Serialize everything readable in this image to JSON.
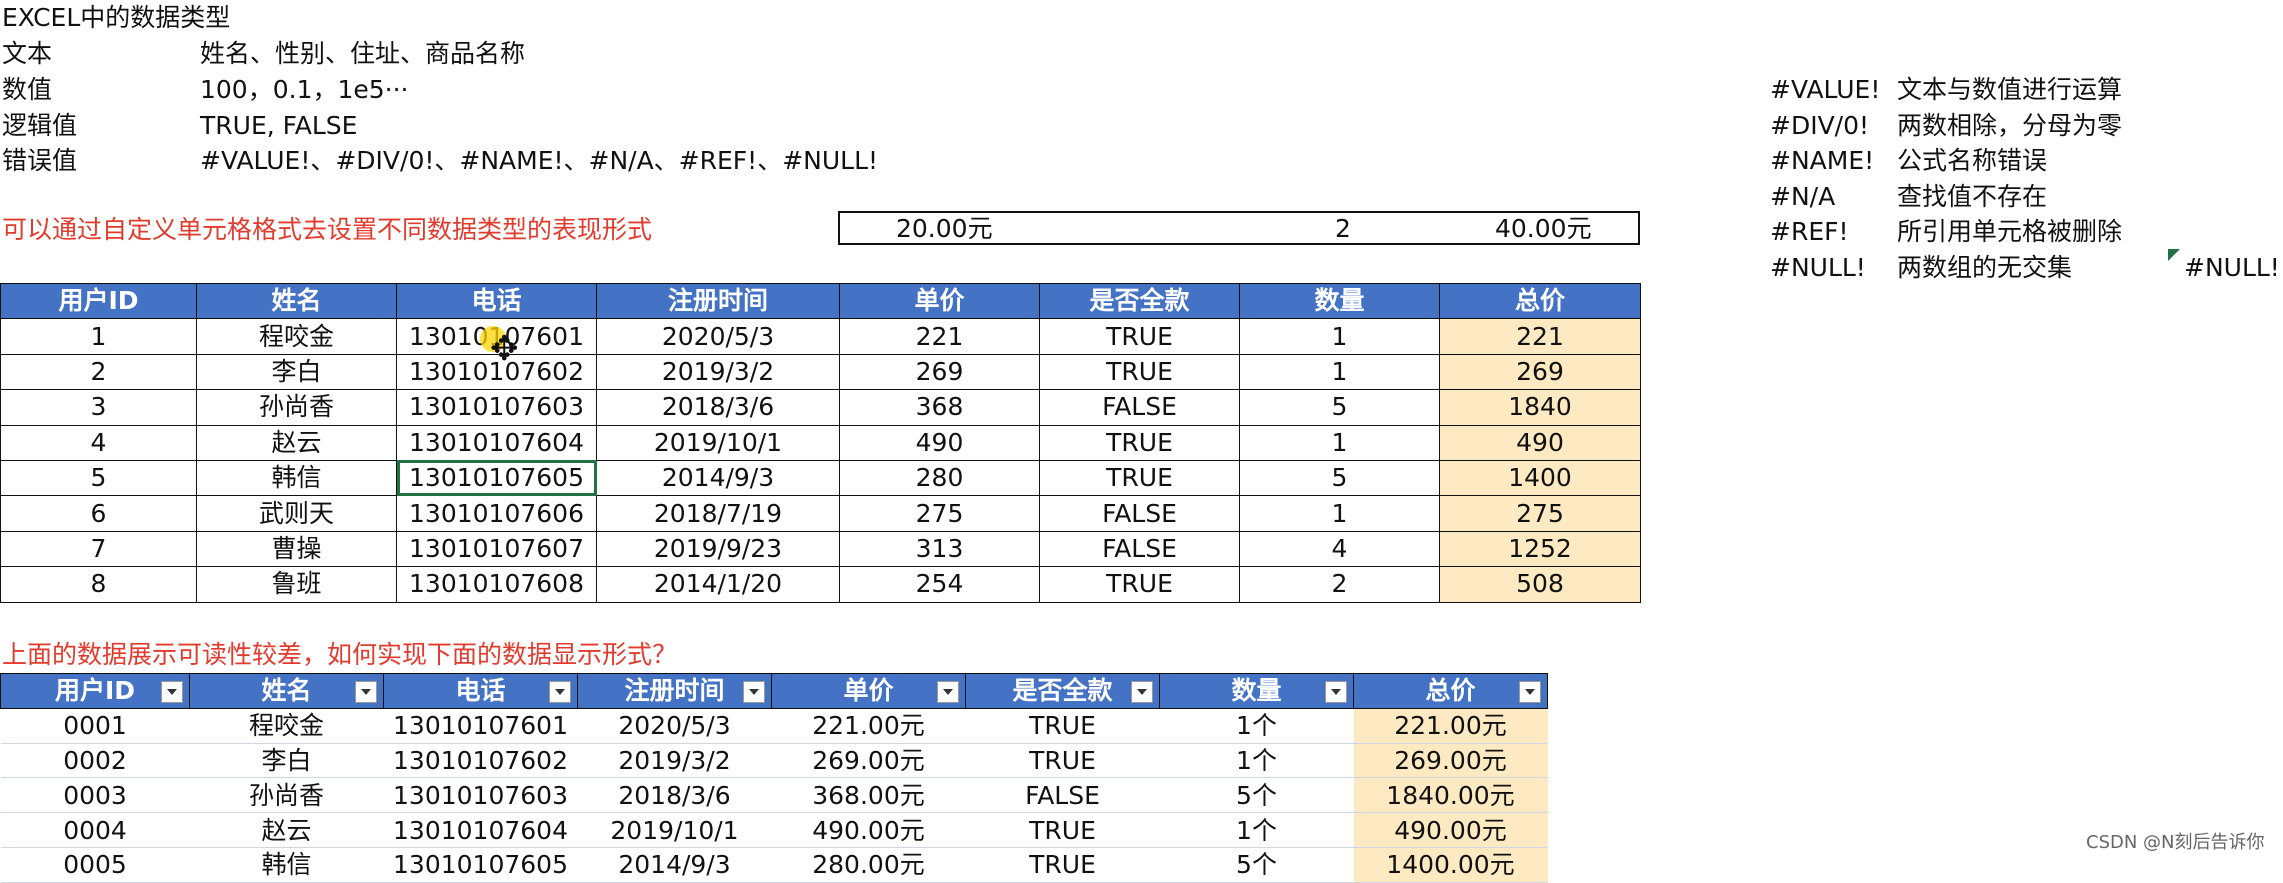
{
  "title": "EXCEL中的数据类型",
  "types": [
    {
      "name": "文本",
      "examples": "姓名、性别、住址、商品名称"
    },
    {
      "name": "数值",
      "examples": "100，0.1，1e5···"
    },
    {
      "name": "逻辑值",
      "examples": "TRUE, FALSE"
    },
    {
      "name": "错误值",
      "examples": "#VALUE!、#DIV/0!、#NAME!、#N/A、#REF!、#NULL!"
    }
  ],
  "format_note": "可以通过自定义单元格格式去设置不同数据类型的表现形式",
  "sample_row": {
    "price": "20.00元",
    "qty": "2",
    "total": "40.00元"
  },
  "errors": [
    {
      "code": "#VALUE!",
      "desc": "文本与数值进行运算"
    },
    {
      "code": "#DIV/0!",
      "desc": "两数相除，分母为零"
    },
    {
      "code": "#NAME!",
      "desc": "公式名称错误"
    },
    {
      "code": "#N/A",
      "desc": "查找值不存在"
    },
    {
      "code": "#REF!",
      "desc": "所引用单元格被删除"
    },
    {
      "code": "#NULL!",
      "desc": "两数组的无交集"
    }
  ],
  "null_cell": "#NULL!",
  "headers": [
    "用户ID",
    "姓名",
    "电话",
    "注册时间",
    "单价",
    "是否全款",
    "数量",
    "总价"
  ],
  "table1_rows": [
    [
      "1",
      "程咬金",
      "13010107601",
      "2020/5/3",
      "221",
      "TRUE",
      "1",
      "221"
    ],
    [
      "2",
      "李白",
      "13010107602",
      "2019/3/2",
      "269",
      "TRUE",
      "1",
      "269"
    ],
    [
      "3",
      "孙尚香",
      "13010107603",
      "2018/3/6",
      "368",
      "FALSE",
      "5",
      "1840"
    ],
    [
      "4",
      "赵云",
      "13010107604",
      "2019/10/1",
      "490",
      "TRUE",
      "1",
      "490"
    ],
    [
      "5",
      "韩信",
      "13010107605",
      "2014/9/3",
      "280",
      "TRUE",
      "5",
      "1400"
    ],
    [
      "6",
      "武则天",
      "13010107606",
      "2018/7/19",
      "275",
      "FALSE",
      "1",
      "275"
    ],
    [
      "7",
      "曹操",
      "13010107607",
      "2019/9/23",
      "313",
      "FALSE",
      "4",
      "1252"
    ],
    [
      "8",
      "鲁班",
      "13010107608",
      "2014/1/20",
      "254",
      "TRUE",
      "2",
      "508"
    ]
  ],
  "question": "上面的数据展示可读性较差，如何实现下面的数据显示形式？",
  "table2_rows": [
    [
      "0001",
      "程咬金",
      "13010107601",
      "2020/5/3",
      "221.00元",
      "TRUE",
      "1个",
      "221.00元"
    ],
    [
      "0002",
      "李白",
      "13010107602",
      "2019/3/2",
      "269.00元",
      "TRUE",
      "1个",
      "269.00元"
    ],
    [
      "0003",
      "孙尚香",
      "13010107603",
      "2018/3/6",
      "368.00元",
      "FALSE",
      "5个",
      "1840.00元"
    ],
    [
      "0004",
      "赵云",
      "13010107604",
      "2019/10/1",
      "490.00元",
      "TRUE",
      "1个",
      "490.00元"
    ],
    [
      "0005",
      "韩信",
      "13010107605",
      "2014/9/3",
      "280.00元",
      "TRUE",
      "5个",
      "1400.00元"
    ]
  ],
  "watermark": "CSDN @N刻后告诉你"
}
